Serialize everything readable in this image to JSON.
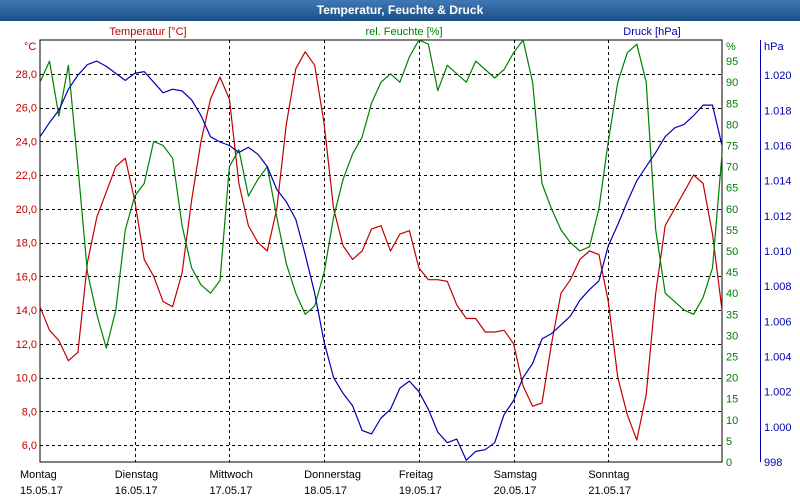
{
  "window": {
    "title": "Temperatur, Feuchte & Druck"
  },
  "colors": {
    "temperature": "#c00000",
    "humidity": "#008000",
    "pressure": "#0000b0",
    "grid": "#000000",
    "title_bg": "#2a5f98"
  },
  "chart_data": {
    "type": "line",
    "title": "Temperatur, Feuchte & Druck",
    "grid": true,
    "x_categories": [
      {
        "day": "Montag",
        "date": "15.05.17"
      },
      {
        "day": "Dienstag",
        "date": "16.05.17"
      },
      {
        "day": "Mittwoch",
        "date": "17.05.17"
      },
      {
        "day": "Donnerstag",
        "date": "18.05.17"
      },
      {
        "day": "Freitag",
        "date": "19.05.17"
      },
      {
        "day": "Samstag",
        "date": "20.05.17"
      },
      {
        "day": "Sonntag",
        "date": "21.05.17"
      }
    ],
    "xlim": [
      0,
      7.2
    ],
    "axes": {
      "temperature": {
        "unit": "°C",
        "ylim": [
          5,
          30
        ],
        "ticks": [
          "6,0",
          "8,0",
          "10,0",
          "12,0",
          "14,0",
          "16,0",
          "18,0",
          "20,0",
          "22,0",
          "24,0",
          "26,0",
          "28,0"
        ]
      },
      "humidity": {
        "unit": "%",
        "ylim": [
          0,
          100
        ],
        "ticks": [
          "0",
          "5",
          "10",
          "15",
          "20",
          "25",
          "30",
          "35",
          "40",
          "45",
          "50",
          "55",
          "60",
          "65",
          "70",
          "75",
          "80",
          "85",
          "90",
          "95"
        ]
      },
      "pressure": {
        "unit": "hPa",
        "ylim": [
          998,
          1022
        ],
        "ticks": [
          "998",
          "1.000",
          "1.002",
          "1.004",
          "1.006",
          "1.008",
          "1.010",
          "1.012",
          "1.014",
          "1.016",
          "1.018",
          "1.020"
        ]
      }
    },
    "series": [
      {
        "name": "Temperatur [°C]",
        "axis": "temperature",
        "x": [
          0.0,
          0.1,
          0.2,
          0.3,
          0.4,
          0.5,
          0.6,
          0.7,
          0.8,
          0.9,
          1.0,
          1.1,
          1.2,
          1.3,
          1.4,
          1.5,
          1.6,
          1.7,
          1.8,
          1.9,
          2.0,
          2.1,
          2.2,
          2.3,
          2.4,
          2.5,
          2.6,
          2.7,
          2.8,
          2.9,
          3.0,
          3.1,
          3.2,
          3.3,
          3.4,
          3.5,
          3.6,
          3.7,
          3.8,
          3.9,
          4.0,
          4.1,
          4.2,
          4.3,
          4.4,
          4.5,
          4.6,
          4.7,
          4.8,
          4.9,
          5.0,
          5.1,
          5.2,
          5.3,
          5.4,
          5.5,
          5.6,
          5.7,
          5.8,
          5.9,
          6.0,
          6.1,
          6.2,
          6.3,
          6.4,
          6.5,
          6.6,
          6.7,
          6.8,
          6.9,
          7.0,
          7.1,
          7.2
        ],
        "y": [
          14.2,
          12.8,
          12.2,
          11.0,
          11.5,
          16.8,
          19.5,
          21.0,
          22.5,
          23.0,
          20.5,
          17.0,
          16.0,
          14.5,
          14.2,
          16.2,
          20.5,
          24.0,
          26.5,
          27.8,
          26.5,
          21.5,
          19.0,
          18.0,
          17.5,
          20.0,
          25.0,
          28.3,
          29.3,
          28.5,
          25.0,
          20.0,
          17.8,
          17.0,
          17.5,
          18.8,
          19.0,
          17.5,
          18.5,
          18.7,
          16.5,
          15.8,
          15.8,
          15.7,
          14.3,
          13.5,
          13.5,
          12.7,
          12.7,
          12.8,
          12.0,
          9.5,
          8.3,
          8.5,
          12.0,
          15.0,
          15.8,
          17.0,
          17.5,
          17.3,
          14.5,
          10.0,
          7.8,
          6.3,
          9.0,
          15.0,
          19.0,
          20.0,
          21.0,
          22.0,
          21.5,
          18.5,
          14.0
        ]
      },
      {
        "name": "rel. Feuchte [%]",
        "axis": "humidity",
        "x": [
          0.0,
          0.1,
          0.2,
          0.3,
          0.4,
          0.5,
          0.6,
          0.7,
          0.8,
          0.9,
          1.0,
          1.1,
          1.2,
          1.3,
          1.4,
          1.5,
          1.6,
          1.7,
          1.8,
          1.9,
          2.0,
          2.1,
          2.2,
          2.3,
          2.4,
          2.5,
          2.6,
          2.7,
          2.8,
          2.9,
          3.0,
          3.1,
          3.2,
          3.3,
          3.4,
          3.5,
          3.6,
          3.7,
          3.8,
          3.9,
          4.0,
          4.1,
          4.2,
          4.3,
          4.4,
          4.5,
          4.6,
          4.7,
          4.8,
          4.9,
          5.0,
          5.1,
          5.2,
          5.3,
          5.4,
          5.5,
          5.6,
          5.7,
          5.8,
          5.9,
          6.0,
          6.1,
          6.2,
          6.3,
          6.4,
          6.5,
          6.6,
          6.7,
          6.8,
          6.9,
          7.0,
          7.1,
          7.2
        ],
        "y": [
          90.0,
          95.0,
          82.0,
          94.0,
          70.0,
          45.0,
          35.0,
          27.0,
          36.0,
          55.0,
          63.0,
          66.0,
          76.0,
          75.0,
          72.0,
          56.0,
          46.0,
          42.0,
          40.0,
          43.0,
          70.0,
          74.0,
          63.0,
          67.0,
          70.0,
          58.0,
          47.0,
          40.0,
          35.0,
          37.0,
          45.0,
          58.0,
          67.0,
          73.0,
          77.0,
          85.0,
          90.0,
          92.0,
          90.0,
          96.0,
          100.0,
          99.0,
          88.0,
          94.0,
          92.0,
          90.0,
          95.0,
          93.0,
          91.0,
          93.0,
          97.0,
          100.0,
          90.0,
          66.0,
          60.0,
          55.0,
          52.0,
          50.0,
          51.0,
          60.0,
          76.0,
          90.0,
          97.0,
          99.0,
          90.0,
          55.0,
          40.0,
          38.0,
          36.0,
          35.0,
          39.0,
          46.0,
          73.0
        ]
      },
      {
        "name": "Druck [hPa]",
        "axis": "pressure",
        "x": [
          0.0,
          0.1,
          0.2,
          0.3,
          0.4,
          0.5,
          0.6,
          0.7,
          0.8,
          0.9,
          1.0,
          1.1,
          1.2,
          1.3,
          1.4,
          1.5,
          1.6,
          1.7,
          1.8,
          1.9,
          2.0,
          2.1,
          2.2,
          2.3,
          2.4,
          2.5,
          2.6,
          2.7,
          2.8,
          2.9,
          3.0,
          3.1,
          3.2,
          3.3,
          3.4,
          3.5,
          3.6,
          3.7,
          3.8,
          3.9,
          4.0,
          4.1,
          4.2,
          4.3,
          4.4,
          4.5,
          4.6,
          4.7,
          4.8,
          4.9,
          5.0,
          5.1,
          5.2,
          5.3,
          5.4,
          5.5,
          5.6,
          5.7,
          5.8,
          5.9,
          6.0,
          6.1,
          6.2,
          6.3,
          6.4,
          6.5,
          6.6,
          6.7,
          6.8,
          6.9,
          7.0,
          7.1,
          7.2
        ],
        "y": [
          1016.5,
          1017.3,
          1018.0,
          1019.2,
          1020.0,
          1020.6,
          1020.8,
          1020.5,
          1020.1,
          1019.7,
          1020.1,
          1020.2,
          1019.6,
          1019.0,
          1019.2,
          1019.1,
          1018.6,
          1017.7,
          1016.5,
          1016.2,
          1016.0,
          1015.6,
          1015.9,
          1015.5,
          1014.8,
          1013.5,
          1012.8,
          1011.8,
          1009.8,
          1007.6,
          1004.8,
          1002.8,
          1001.9,
          1001.2,
          999.8,
          999.6,
          1000.5,
          1001.0,
          1002.2,
          1002.6,
          1002.0,
          1001.0,
          999.7,
          999.1,
          999.3,
          998.1,
          998.6,
          998.7,
          999.1,
          1000.7,
          1001.5,
          1002.8,
          1003.6,
          1005.0,
          1005.3,
          1005.8,
          1006.3,
          1007.2,
          1007.8,
          1008.3,
          1010.3,
          1011.5,
          1012.8,
          1014.0,
          1014.8,
          1015.6,
          1016.5,
          1017.0,
          1017.2,
          1017.7,
          1018.3,
          1018.3,
          1016.0
        ]
      }
    ]
  }
}
